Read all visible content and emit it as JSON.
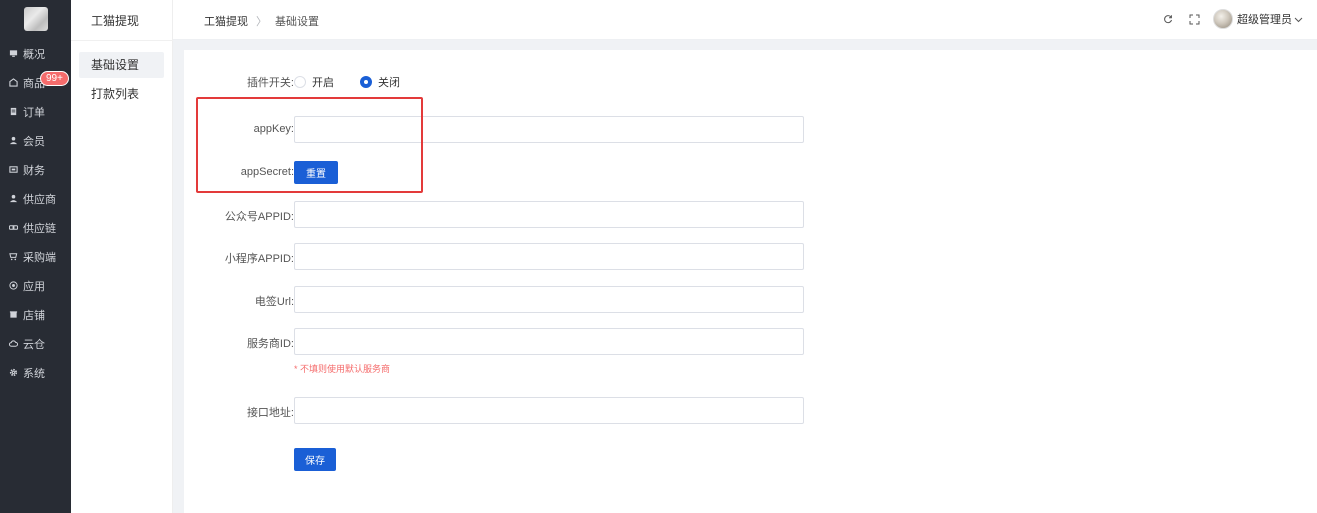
{
  "nav": {
    "items": [
      {
        "label": "概况",
        "icon": "monitor-icon"
      },
      {
        "label": "商品",
        "icon": "shop-icon",
        "badge": "99+"
      },
      {
        "label": "订单",
        "icon": "order-icon"
      },
      {
        "label": "会员",
        "icon": "user-icon"
      },
      {
        "label": "财务",
        "icon": "finance-icon"
      },
      {
        "label": "供应商",
        "icon": "supplier-icon"
      },
      {
        "label": "供应链",
        "icon": "chain-icon"
      },
      {
        "label": "采购端",
        "icon": "cart-icon"
      },
      {
        "label": "应用",
        "icon": "app-icon"
      },
      {
        "label": "店铺",
        "icon": "store-icon"
      },
      {
        "label": "云仓",
        "icon": "cloud-icon"
      },
      {
        "label": "系统",
        "icon": "gear-icon"
      }
    ]
  },
  "subnav": {
    "title": "工猫提现",
    "items": [
      {
        "label": "基础设置",
        "active": true
      },
      {
        "label": "打款列表",
        "active": false
      }
    ]
  },
  "header": {
    "breadcrumb": [
      "工猫提现",
      "基础设置"
    ],
    "user_name": "超级管理员",
    "icons": [
      "refresh-icon",
      "fullscreen-icon",
      "chevron-down-icon"
    ]
  },
  "form": {
    "plugin_switch": {
      "label": "插件开关:",
      "options": [
        {
          "label": "开启",
          "checked": false
        },
        {
          "label": "关闭",
          "checked": true
        }
      ]
    },
    "app_key": {
      "label": "appKey:",
      "value": ""
    },
    "app_secret": {
      "label": "appSecret:",
      "button": "重置"
    },
    "mp_appid": {
      "label": "公众号APPID:",
      "value": ""
    },
    "mini_appid": {
      "label": "小程序APPID:",
      "value": ""
    },
    "sign_url": {
      "label": "电签Url:",
      "value": ""
    },
    "provider_id": {
      "label": "服务商ID:",
      "value": "",
      "hint": "* 不填则使用默认服务商"
    },
    "api_url": {
      "label": "接口地址:",
      "value": ""
    },
    "save_button": "保存"
  },
  "colors": {
    "primary": "#1a5fd6",
    "nav_bg": "#282c34",
    "highlight": "#e33a3a",
    "badge": "#f56c6c"
  }
}
